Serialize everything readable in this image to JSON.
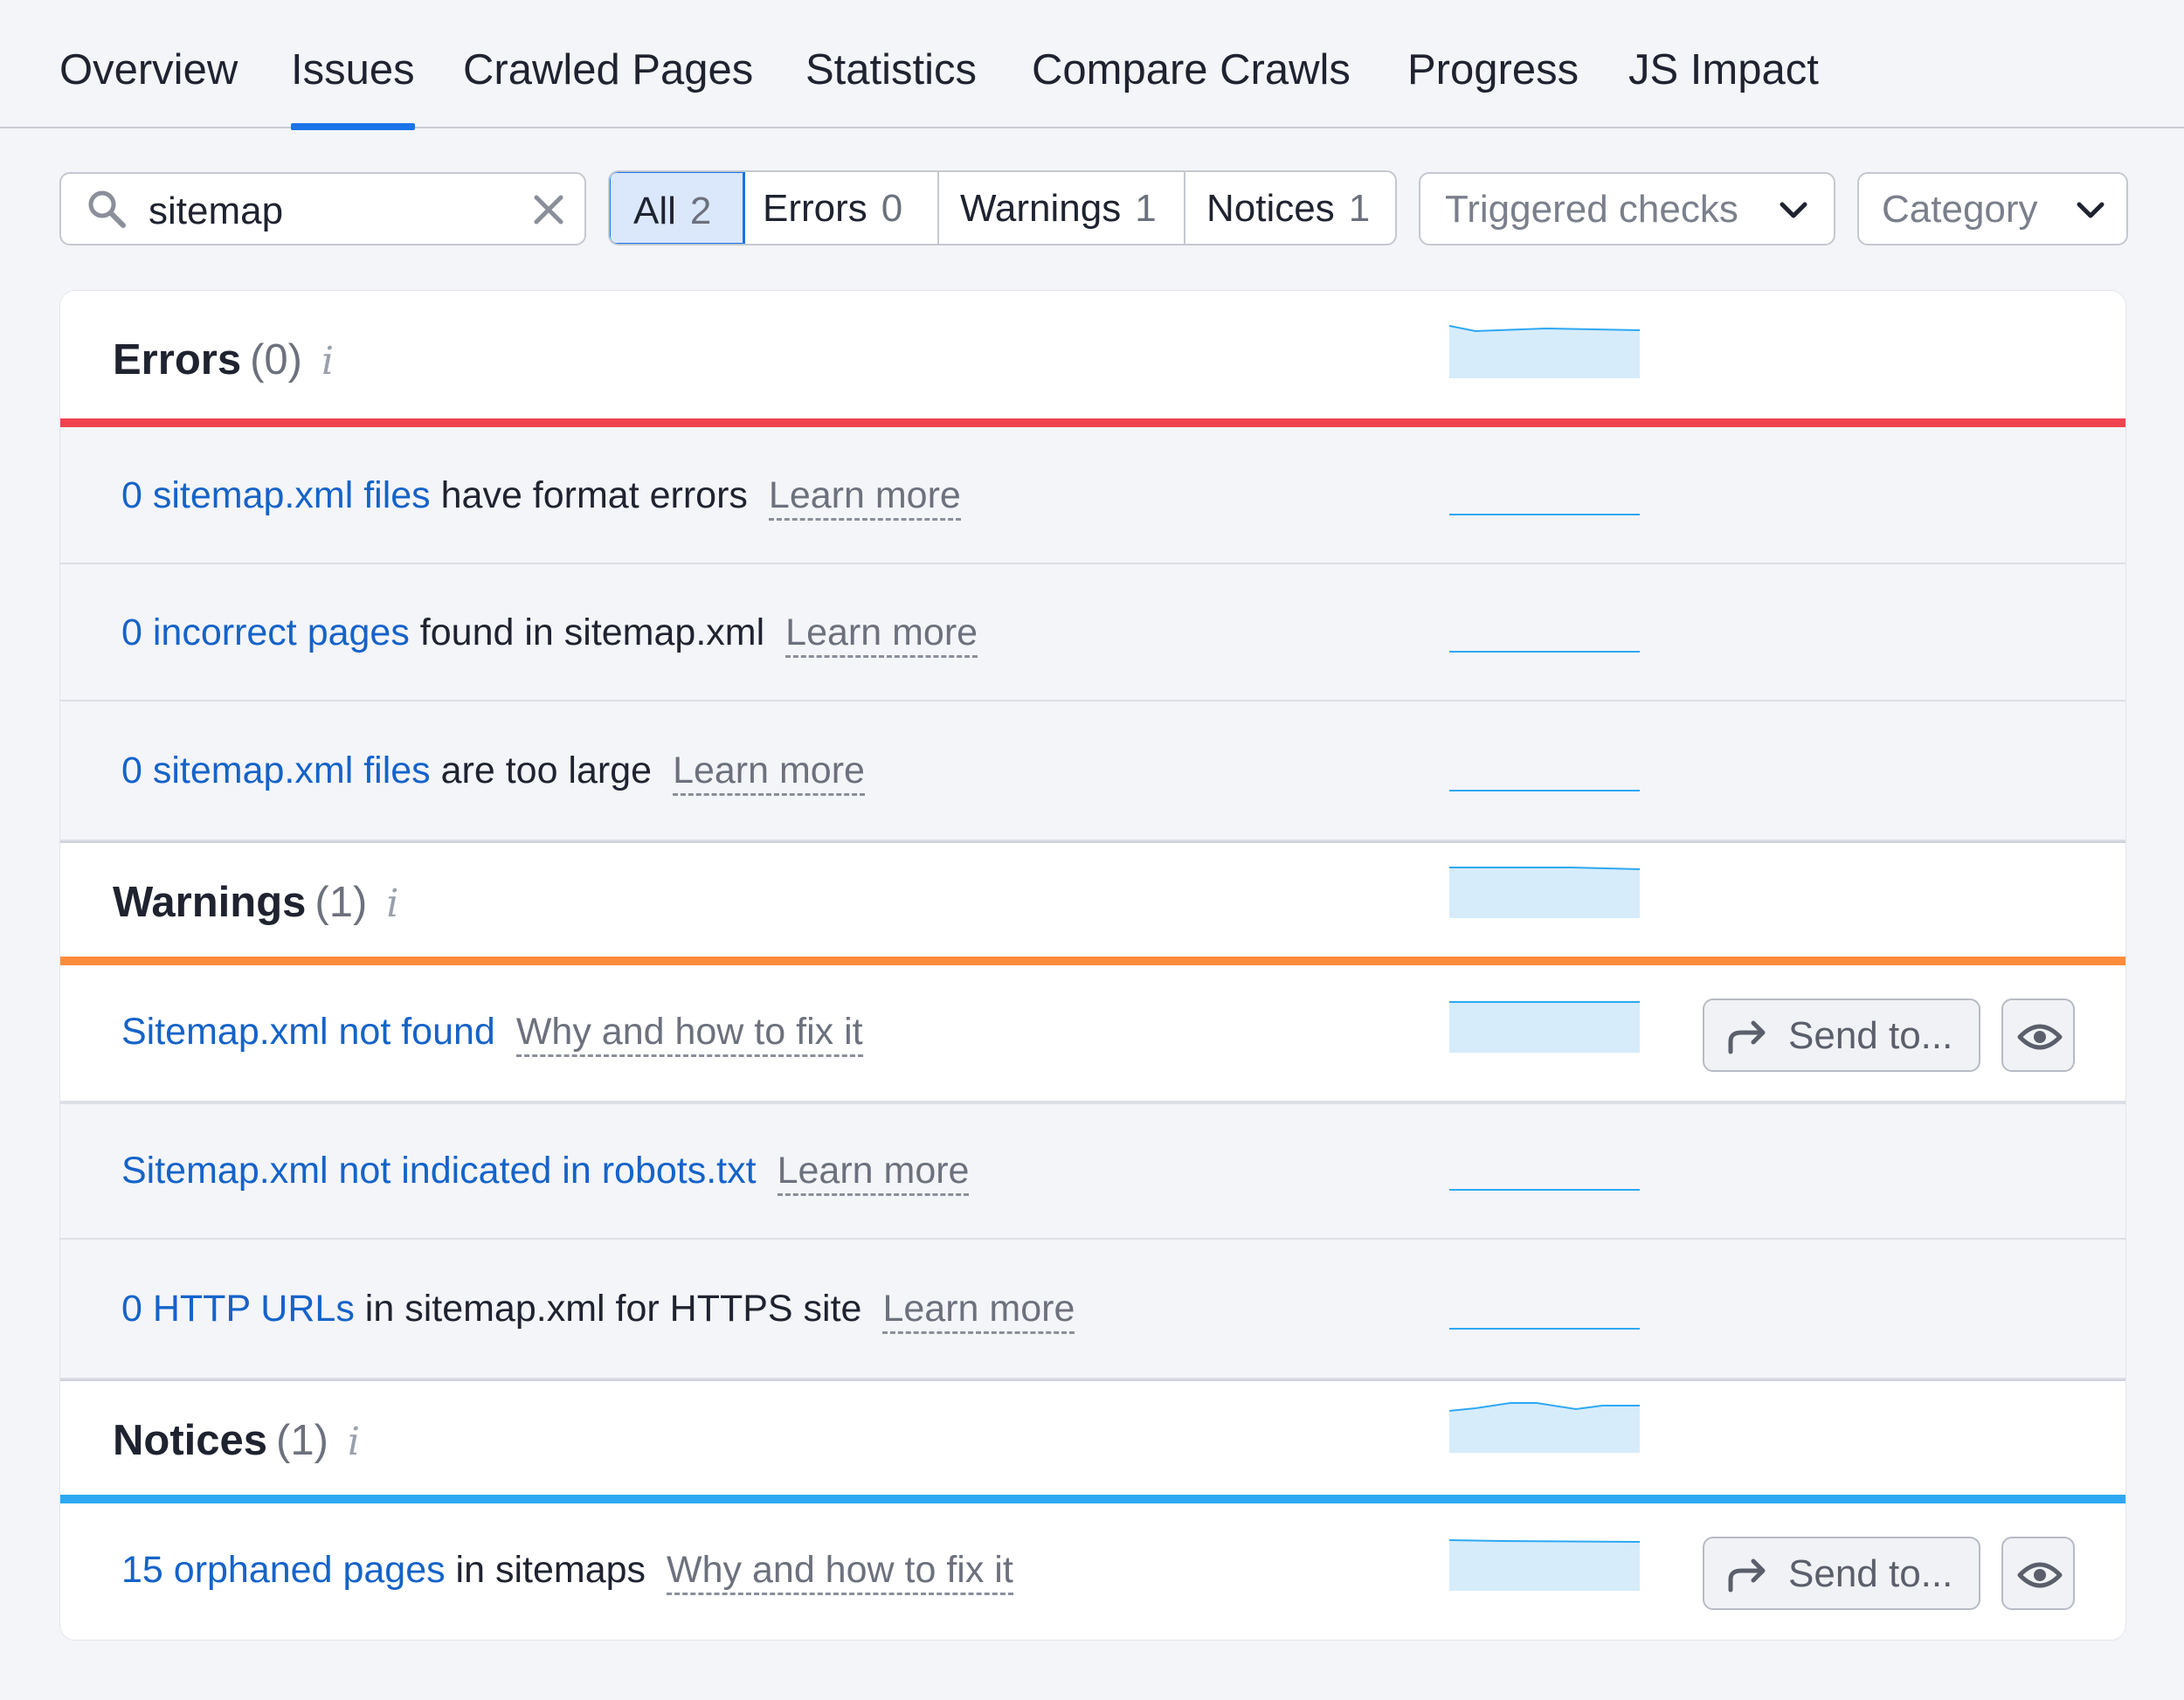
{
  "tabs": [
    {
      "label": "Overview"
    },
    {
      "label": "Issues"
    },
    {
      "label": "Crawled Pages"
    },
    {
      "label": "Statistics"
    },
    {
      "label": "Compare Crawls"
    },
    {
      "label": "Progress"
    },
    {
      "label": "JS Impact"
    }
  ],
  "active_tab": "Issues",
  "search": {
    "value": "sitemap"
  },
  "filters": [
    {
      "label": "All",
      "count": "2"
    },
    {
      "label": "Errors",
      "count": "0"
    },
    {
      "label": "Warnings",
      "count": "1"
    },
    {
      "label": "Notices",
      "count": "1"
    }
  ],
  "active_filter": "All",
  "dropdowns": {
    "triggered": "Triggered checks",
    "category": "Category"
  },
  "sections": {
    "errors": {
      "title": "Errors",
      "count": "(0)",
      "info": "i",
      "color": "#f0434f"
    },
    "warnings": {
      "title": "Warnings",
      "count": "(1)",
      "info": "i",
      "color": "#ff8c3a"
    },
    "notices": {
      "title": "Notices",
      "count": "(1)",
      "info": "i",
      "color": "#2ea8f2"
    }
  },
  "issues": {
    "e1": {
      "link": "0 sitemap.xml files",
      "text": " have format errors",
      "help": "Learn more"
    },
    "e2": {
      "link": "0 incorrect pages",
      "text": " found in sitemap.xml",
      "help": "Learn more"
    },
    "e3": {
      "link": "0 sitemap.xml files",
      "text": " are too large",
      "help": "Learn more"
    },
    "w1": {
      "link": "Sitemap.xml not found",
      "text": "",
      "help": "Why and how to fix it"
    },
    "w2": {
      "link": "Sitemap.xml not indicated in robots.txt",
      "text": "",
      "help": "Learn more"
    },
    "w3": {
      "link": "0 HTTP URLs",
      "text": " in sitemap.xml for HTTPS site",
      "help": "Learn more"
    },
    "n1": {
      "link": "15 orphaned pages",
      "text": " in sitemaps",
      "help": "Why and how to fix it"
    }
  },
  "actions": {
    "send_label": "Send to..."
  },
  "colors": {
    "accent": "#1a73e8",
    "link": "#1563c9",
    "spark_fill": "#d6ecfb",
    "spark_line": "#2ea8f2"
  },
  "icons": {
    "search": "search-icon",
    "clear": "close-icon",
    "chevron": "chevron-down-icon",
    "send": "share-arrow-icon",
    "view": "eye-icon",
    "info": "info-icon"
  }
}
